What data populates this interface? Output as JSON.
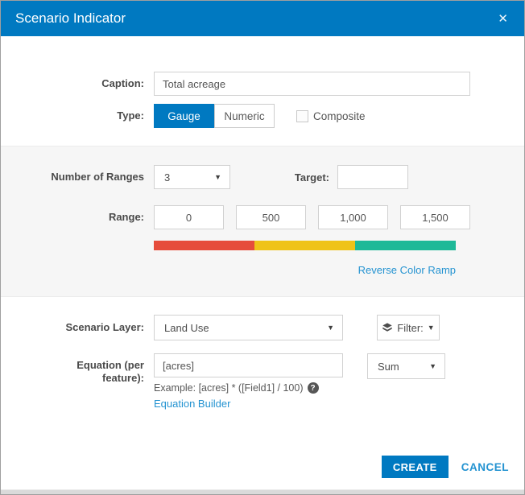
{
  "dialog": {
    "title": "Scenario Indicator"
  },
  "icons": {
    "close": "✕",
    "caret": "▼",
    "help": "?"
  },
  "colors": {
    "accent": "#0079c1",
    "link": "#2493d1",
    "ramp": [
      "#e64c3c",
      "#efc319",
      "#1eb998"
    ]
  },
  "form": {
    "caption": {
      "label": "Caption:",
      "value": "Total acreage"
    },
    "type": {
      "label": "Type:",
      "options": [
        {
          "label": "Gauge",
          "selected": true
        },
        {
          "label": "Numeric",
          "selected": false
        }
      ],
      "composite": {
        "label": "Composite",
        "checked": false
      }
    },
    "ranges": {
      "number_of_ranges_label": "Number of Ranges",
      "number_of_ranges_value": "3",
      "target_label": "Target:",
      "target_value": "",
      "range_label": "Range:",
      "values": [
        "0",
        "500",
        "1,000",
        "1,500"
      ],
      "reverse_link": "Reverse Color Ramp"
    },
    "scenario_layer": {
      "label": "Scenario Layer:",
      "value": "Land Use",
      "filter_label": "Filter:"
    },
    "equation": {
      "label": "Equation (per feature):",
      "value": "[acres]",
      "example": "Example: [acres] * ([Field1] / 100)",
      "builder_link": "Equation Builder",
      "aggregation": "Sum"
    }
  },
  "footer": {
    "create": "CREATE",
    "cancel": "CANCEL"
  }
}
